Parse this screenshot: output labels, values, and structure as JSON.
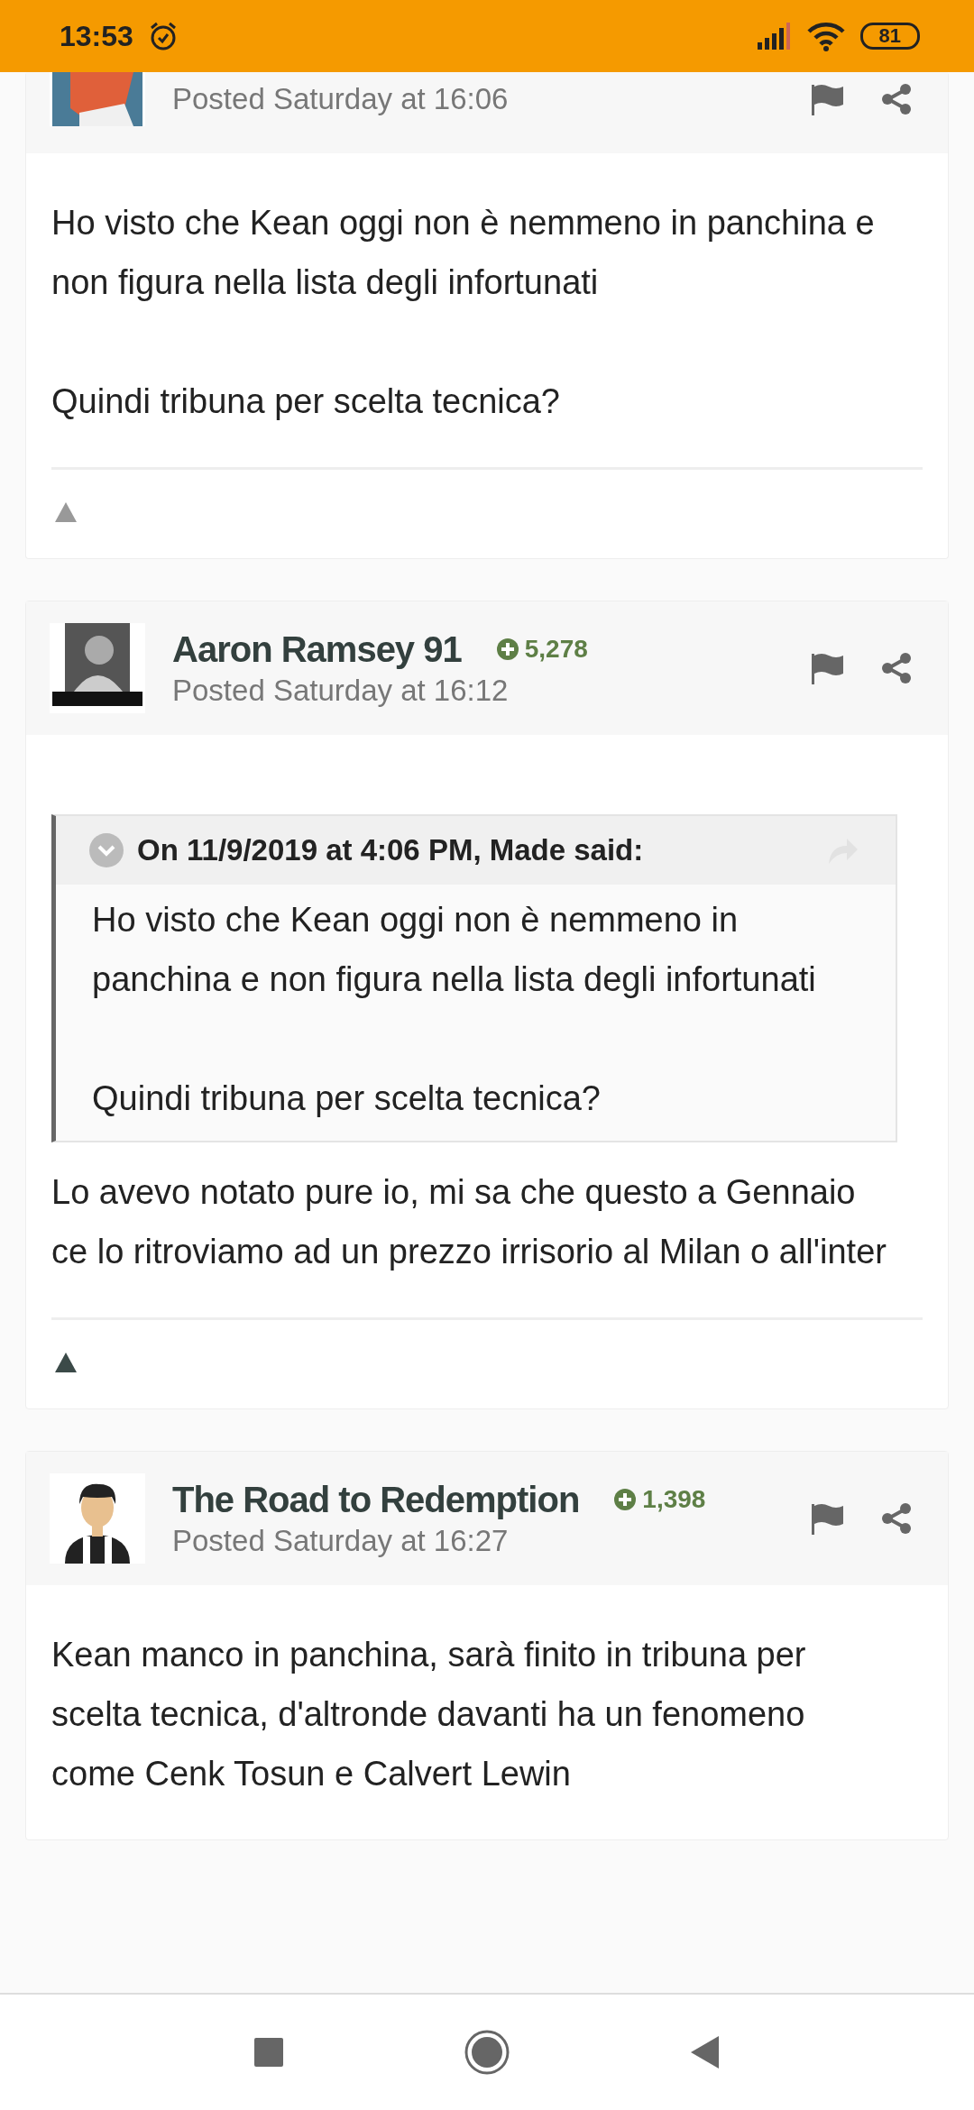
{
  "status_bar": {
    "time": "13:53",
    "battery": "81"
  },
  "posts": [
    {
      "avatar": {
        "kind": "cartoon"
      },
      "posted": "Posted Saturday at 16:06",
      "paragraphs": [
        "Ho visto che Kean oggi non è nemmeno in panchina e non figura nella lista degli infortunati",
        "Quindi tribuna per scelta tecnica?"
      ],
      "upvoted": false
    },
    {
      "author": "Aaron Ramsey 91",
      "reputation": "5,278",
      "avatar": {
        "kind": "photo"
      },
      "posted": "Posted Saturday at 16:12",
      "quote": {
        "header": "On 11/9/2019 at 4:06 PM, Made said:",
        "paragraphs": [
          "Ho visto che Kean oggi non è nemmeno in panchina e non figura nella lista degli infortunati",
          "Quindi tribuna per scelta tecnica?"
        ]
      },
      "paragraphs": [
        "Lo avevo notato pure io, mi sa che questo a Gennaio ce lo ritroviamo ad un prezzo irrisorio al Milan o all'inter"
      ],
      "upvoted": true
    },
    {
      "author": "The Road to Redemption",
      "reputation": "1,398",
      "avatar": {
        "kind": "silhouette"
      },
      "posted": "Posted Saturday at 16:27",
      "paragraphs": [
        "Kean manco in panchina, sarà finito in tribuna per scelta tecnica, d'altronde davanti ha un fenomeno come Cenk Tosun e Calvert Lewin"
      ]
    }
  ]
}
